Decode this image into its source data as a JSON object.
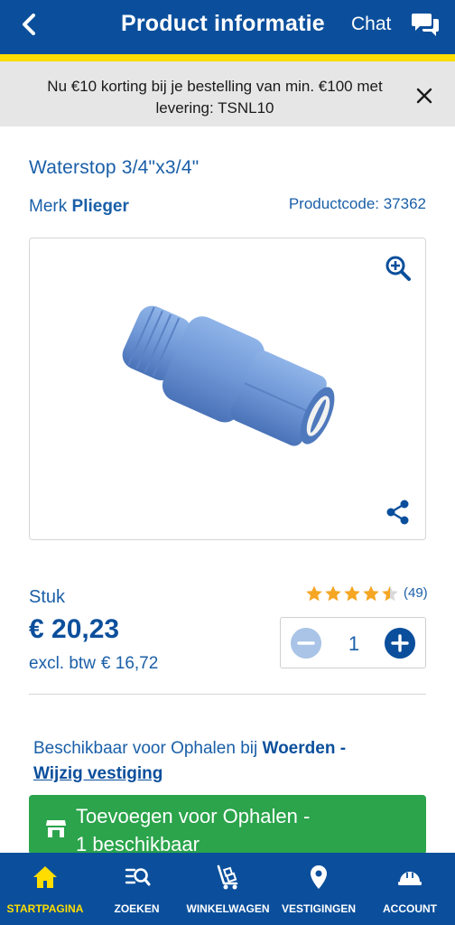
{
  "header": {
    "title": "Product informatie",
    "chat_label": "Chat"
  },
  "promo": {
    "text": "Nu €10 korting bij je bestelling van min. €100 met levering: TSNL10"
  },
  "product": {
    "title": "Waterstop 3/4\"x3/4\"",
    "brand_prefix": "Merk",
    "brand": "Plieger",
    "code": "Productcode: 37362",
    "unit": "Stuk",
    "price": "€ 20,23",
    "vat_label": "excl. btw",
    "vat_price": "€ 16,72",
    "rating": 4.5,
    "rating_max": 5,
    "review_count": "(49)",
    "quantity": "1"
  },
  "availability": {
    "prefix": "Beschikbaar voor Ophalen bij",
    "store": "Woerden -",
    "change_link": "Wijzig vestiging"
  },
  "add_button": {
    "line1": "Toevoegen voor Ophalen -",
    "line2": "1 beschikbaar"
  },
  "nav": {
    "items": [
      {
        "label": "STARTPAGINA",
        "icon": "home-icon",
        "active": true
      },
      {
        "label": "ZOEKEN",
        "icon": "search-list-icon",
        "active": false
      },
      {
        "label": "WINKELWAGEN",
        "icon": "cart-icon",
        "active": false
      },
      {
        "label": "VESTIGINGEN",
        "icon": "location-pin-icon",
        "active": false
      },
      {
        "label": "ACCOUNT",
        "icon": "helmet-icon",
        "active": false
      }
    ]
  },
  "colors": {
    "brand_blue": "#0b4f9c",
    "accent_yellow": "#ffdd00",
    "green": "#2ba44b",
    "star": "#f5a623"
  }
}
